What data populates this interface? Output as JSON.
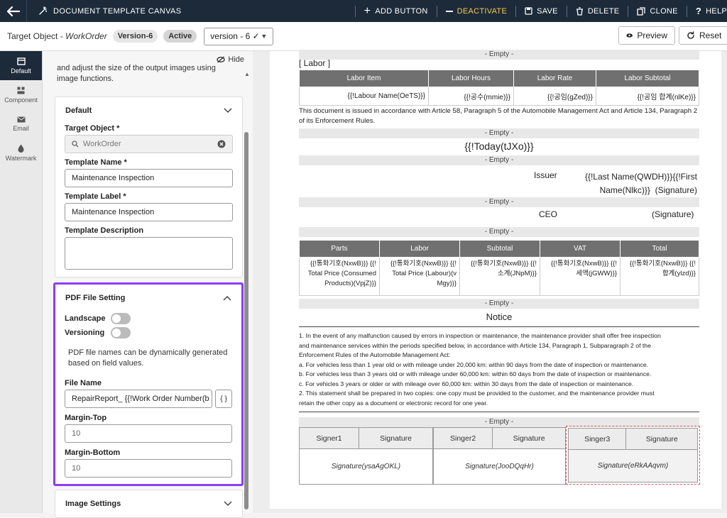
{
  "app": {
    "title": "DOCUMENT TEMPLATE CANVAS",
    "toolbar": {
      "add_button": "ADD BUTTON",
      "deactivate": "DEACTIVATE",
      "save": "SAVE",
      "delete": "DELETE",
      "clone": "CLONE",
      "help": "HELP"
    },
    "colors": {
      "topbar": "#1d2a3a",
      "deactivate": "#f2c94c",
      "highlight": "#8e3cf5"
    }
  },
  "subheader": {
    "target_prefix": "Target Object - ",
    "target_value": "WorkOrder",
    "version_badge": "Version-6",
    "status_badge": "Active",
    "version_select": "version - 6 ✓",
    "preview": "Preview",
    "reset": "Reset"
  },
  "rail": [
    {
      "label": "Default",
      "icon": "layout-icon",
      "selected": true
    },
    {
      "label": "Component",
      "icon": "component-icon",
      "selected": false
    },
    {
      "label": "Email",
      "icon": "email-icon",
      "selected": false
    },
    {
      "label": "Watermark",
      "icon": "watermark-icon",
      "selected": false
    }
  ],
  "panel": {
    "hide": "Hide",
    "intro": "and adjust the size of the output images using image functions.",
    "default_section": {
      "title": "Default",
      "target_object_label": "Target Object *",
      "target_object_value": "WorkOrder",
      "template_name_label": "Template Name *",
      "template_name_value": "Maintenance Inspection",
      "template_label_label": "Template Label *",
      "template_label_value": "Maintenance Inspection",
      "description_label": "Template Description",
      "description_value": ""
    },
    "pdf_section": {
      "title": "PDF File Setting",
      "landscape": "Landscape",
      "versioning": "Versioning",
      "help_text": "PDF file names can be dynamically generated based on field values.",
      "file_name_label": "File Name",
      "file_name_value": "RepairReport_ {{!Work Order Number(b",
      "file_name_btn": "{ }",
      "margin_top_label": "Margin-Top",
      "margin_top_value": "10",
      "margin_bottom_label": "Margin-Bottom",
      "margin_bottom_value": "10"
    },
    "image_section": {
      "title": "Image Settings"
    }
  },
  "document": {
    "empty_label": "- Empty -",
    "labor_heading": "[ Labor ]",
    "labor_table": {
      "headers": [
        "Labor Item",
        "Labor Hours",
        "Labor Rate",
        "Labor Subtotal"
      ],
      "row": [
        "{{!Labour Name(OeTS)}}",
        "{{!공수(mmie)}}",
        "{{!공임(gZed)}}",
        "{{!공임 합계(nlKe)}}"
      ]
    },
    "article_text": "This document is issued in accordance with Article 58, Paragraph 5 of the Automobile Management Act and Article 134, Paragraph 2 of its Enforcement Rules.",
    "today": "{{!Today(tJXo)}}",
    "issuer_label": "Issuer",
    "issuer_value_1": "{{!Last Name(QWDH)}}{{!First",
    "issuer_value_2": "Name(Nlkc)}}",
    "signature_label": "(Signature)",
    "ceo_label": "CEO",
    "totals_table": {
      "headers": [
        "Parts",
        "Labor",
        "Subtotal",
        "VAT",
        "Total"
      ],
      "cells": [
        [
          "{{!통화기호(NxwB)}} {{!",
          "Total Price (Consumed",
          "Products)(VpjZ)}}"
        ],
        [
          "{{!통화기호(NxwB)}} {{!",
          "Total Price (Labour)(v",
          "Mgy)}}"
        ],
        [
          "{{!통화기호(NxwB)}} {{!",
          "소계(JNpM)}}"
        ],
        [
          "{{!통화기호(NxwB)}} {{!",
          "세액(jGWW)}}"
        ],
        [
          "{{!통화기호(NxwB)}} {{!",
          "합계(ylzd)}}"
        ]
      ]
    },
    "notice_title": "Notice",
    "notice_lines": [
      "1. In the event of any malfunction caused by errors in inspection or maintenance, the maintenance provider shall offer free inspection",
      "and maintenance services within the periods specified below, in accordance with Article 134, Paragraph 1, Subparagraph 2 of the",
      "Enforcement Rules of the Automobile Management Act:",
      "a. For vehicles less than 1 year old or with mileage under 20,000 km: within 90 days from the date of inspection or maintenance.",
      "b. For vehicles less than 3 years old or with mileage under 60,000 km: within 60 days from the date of inspection or maintenance.",
      "c. For vehicles 3 years or older or with mileage over 60,000 km: within 30 days from the date of inspection or maintenance.",
      "2. This statement shall be prepared in two copies: one copy must be provided to the customer, and the maintenance provider must",
      "retain the other copy as a document or electronic record for one year."
    ],
    "signers": [
      {
        "label": "Signer1",
        "sig_header": "Signature",
        "sig": "Signature(ysaAgOKL)"
      },
      {
        "label": "Singer2",
        "sig_header": "Signature",
        "sig": "Signature(JooDQqHr)"
      },
      {
        "label": "Singer3",
        "sig_header": "Signature",
        "sig": "Signature(eRkAAqvm)"
      }
    ]
  }
}
